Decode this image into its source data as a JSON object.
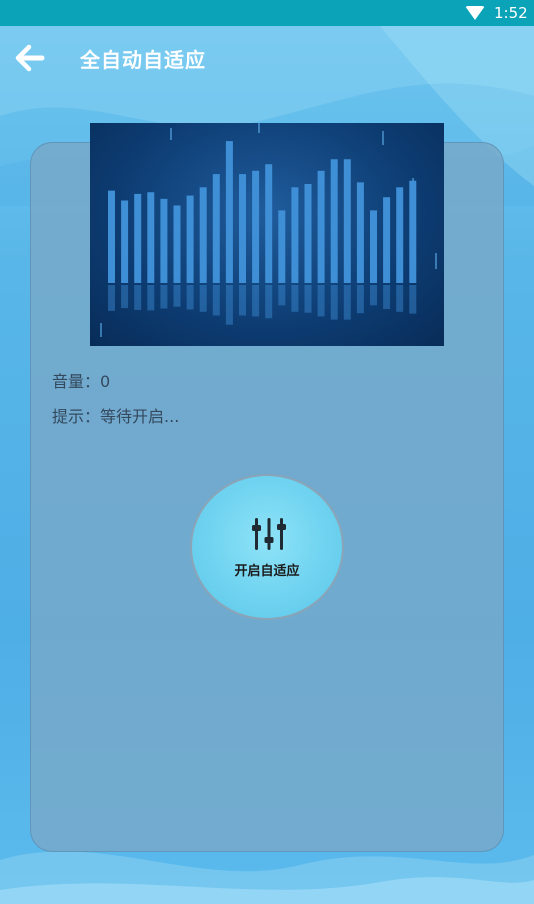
{
  "status_bar": {
    "time": "1:52",
    "wifi_icon": "wifi-icon"
  },
  "toolbar": {
    "back_icon": "arrow-left-icon",
    "title": "全自动自适应"
  },
  "spectrum": {
    "bar_levels": [
      0.56,
      0.5,
      0.54,
      0.55,
      0.51,
      0.47,
      0.53,
      0.58,
      0.66,
      0.86,
      0.66,
      0.68,
      0.72,
      0.44,
      0.58,
      0.6,
      0.68,
      0.75,
      0.75,
      0.61,
      0.44,
      0.52,
      0.58,
      0.62
    ],
    "bar_color": "#3f8fd6"
  },
  "info": {
    "volume_label": "音量：",
    "volume_value": "0",
    "hint_label": "提示：",
    "hint_value": "等待开启..."
  },
  "start_button": {
    "icon": "equalizer-icon",
    "label": "开启自适应"
  },
  "colors": {
    "status_bar": "#0aa3b8",
    "card": "#78a8c8",
    "button": "#6fd3f0",
    "text": "#34495e"
  }
}
